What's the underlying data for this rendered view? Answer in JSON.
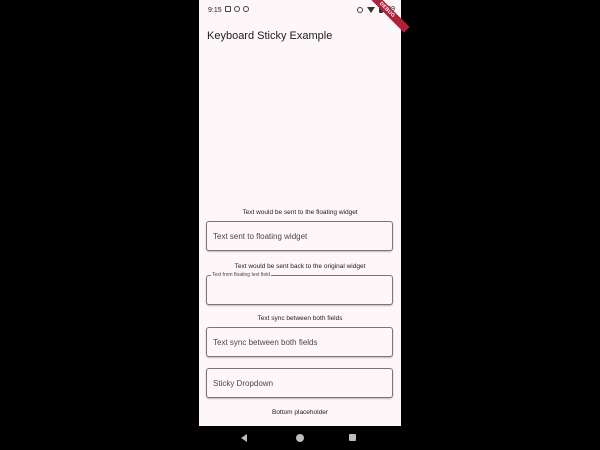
{
  "status_bar": {
    "time": "9:15",
    "battery_text": "99"
  },
  "debug_banner": "DEBUG",
  "app": {
    "title": "Keyboard Sticky Example"
  },
  "form": {
    "label_1": "Text would be sent to the floating widget",
    "field_1_hint": "Text sent to floating widget",
    "label_2": "Text would be sent back to the original widget",
    "field_2_label": "Text from floating text field",
    "label_3": "Text sync between both fields",
    "field_3_hint": "Text sync between both fields",
    "dropdown_hint": "Sticky Dropdown",
    "bottom_placeholder": "Bottom placeholder"
  },
  "icons": {
    "nav_back": "back-triangle-icon",
    "nav_home": "home-circle-icon",
    "nav_recents": "recents-square-icon"
  }
}
